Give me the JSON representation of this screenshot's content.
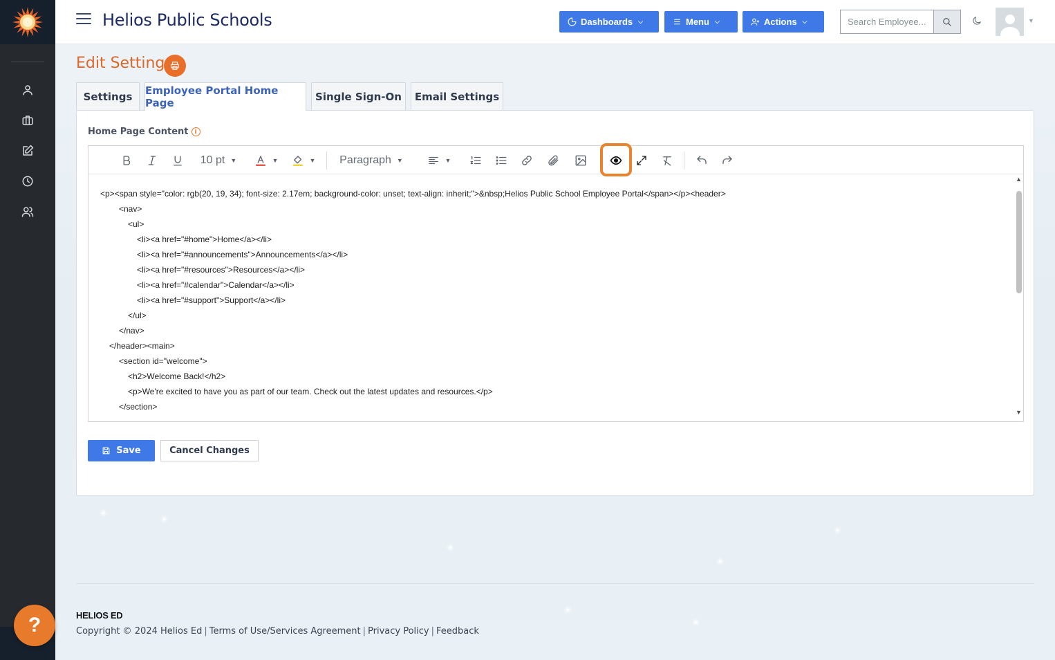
{
  "header": {
    "app_title": "Helios Public Schools",
    "dashboards_label": "Dashboards",
    "menu_label": "Menu",
    "actions_label": "Actions",
    "search_placeholder": "Search Employee..."
  },
  "page": {
    "title": "Edit Settings"
  },
  "tabs": [
    {
      "label": "Settings"
    },
    {
      "label": "Employee Portal Home Page"
    },
    {
      "label": "Single Sign-On"
    },
    {
      "label": "Email Settings"
    }
  ],
  "form": {
    "field_label": "Home Page Content",
    "font_size": "10 pt",
    "block_format": "Paragraph",
    "save_label": "Save",
    "cancel_label": "Cancel Changes"
  },
  "editor_content": [
    "<p><span style=\"color: rgb(20, 19, 34); font-size: 2.17em; background-color: unset; text-align: inherit;\">&nbsp;Helios Public School Employee Portal</span></p><header>",
    "<nav>",
    "<ul>",
    "<li><a href=\"#home\">Home</a></li>",
    "<li><a href=\"#announcements\">Announcements</a></li>",
    "<li><a href=\"#resources\">Resources</a></li>",
    "<li><a href=\"#calendar\">Calendar</a></li>",
    "<li><a href=\"#support\">Support</a></li>",
    "</ul>",
    "</nav>",
    "</header><main>",
    "<section id=\"welcome\">",
    "<h2>Welcome Back!</h2>",
    "<p>We're excited to have you as part of our team. Check out the latest updates and resources.</p>",
    "</section>"
  ],
  "footer": {
    "brand": "HELIOS ED",
    "copyright": "Copyright © 2024 Helios Ed",
    "terms": "Terms of Use/Services Agreement",
    "privacy": "Privacy Policy",
    "feedback": "Feedback"
  },
  "help_label": "?",
  "colors": {
    "accent": "#3f79e8",
    "brand_orange": "#e8832e",
    "sidebar": "#262a2f",
    "title_orange": "#d9692b"
  },
  "icons": {
    "sidebar": [
      "user-icon",
      "briefcase-icon",
      "edit-icon",
      "clock-icon",
      "users-icon"
    ],
    "toolbar": [
      "bold-icon",
      "italic-icon",
      "underline-icon",
      "font-color-icon",
      "highlight-icon",
      "align-icon",
      "ordered-list-icon",
      "bullet-list-icon",
      "link-icon",
      "attachment-icon",
      "image-icon",
      "preview-eye-icon",
      "fullscreen-icon",
      "clear-format-icon",
      "undo-icon",
      "redo-icon"
    ]
  }
}
